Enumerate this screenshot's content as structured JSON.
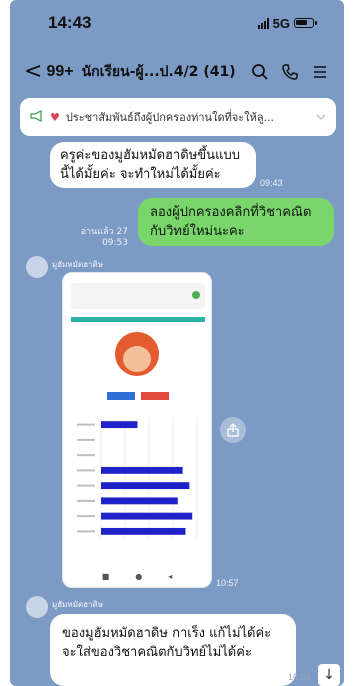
{
  "status_bar": {
    "time": "14:43",
    "network": "5G"
  },
  "header": {
    "back_symbol": "<",
    "unread_count": "99+",
    "room_title": "นักเรียน-ผู้...ป.4/2 (41)"
  },
  "announcement": {
    "text": "ประชาสัมพันธ์ถึงผู้ปกครองท่านใดที่จะให้ลู..."
  },
  "messages": [
    {
      "direction": "in",
      "text": "ครูค่ะของมูฮัมหมัดฮาดิษขึ้นแบบนี้ได้มั้ยค่ะ จะทำใหม่ได้มั้ยค่ะ",
      "time": "09:43"
    },
    {
      "direction": "out",
      "text": "ลองผู้ปกครองคลิกที่วิชาคณิตกับวิทย์ใหม่นะคะ",
      "read_label": "อ่านแล้ว 27",
      "time": "09:53"
    },
    {
      "direction": "in",
      "sender": "มูฮัมหมัดฮาดิษ",
      "type": "image",
      "time": "10:57"
    },
    {
      "direction": "in",
      "sender": "มูฮัมหมัดฮาดิษ",
      "text": "ของมูฮัมหมัดฮาดิษ กาเร็ง แก้ไม่ได้ค่ะ จะใส่ของวิชาคณิตกับวิทย์ไม่ได้ค่ะ",
      "time": "10:58"
    }
  ],
  "chart_data": {
    "type": "bar",
    "categories": [
      "",
      "",
      "",
      "",
      "",
      "",
      "",
      ""
    ],
    "values": [
      0.38,
      0,
      0,
      0.85,
      0.92,
      0.8,
      0.95,
      0.88
    ]
  },
  "icons": {
    "search": "search-icon",
    "call": "phone-icon",
    "menu": "menu-icon",
    "announce": "megaphone-icon",
    "share": "share-icon",
    "down": "arrow-down-icon"
  },
  "colors": {
    "chat_bg": "#7b9ac4",
    "outgoing_bubble": "#78d66a",
    "bar_color": "#1f22c8"
  }
}
